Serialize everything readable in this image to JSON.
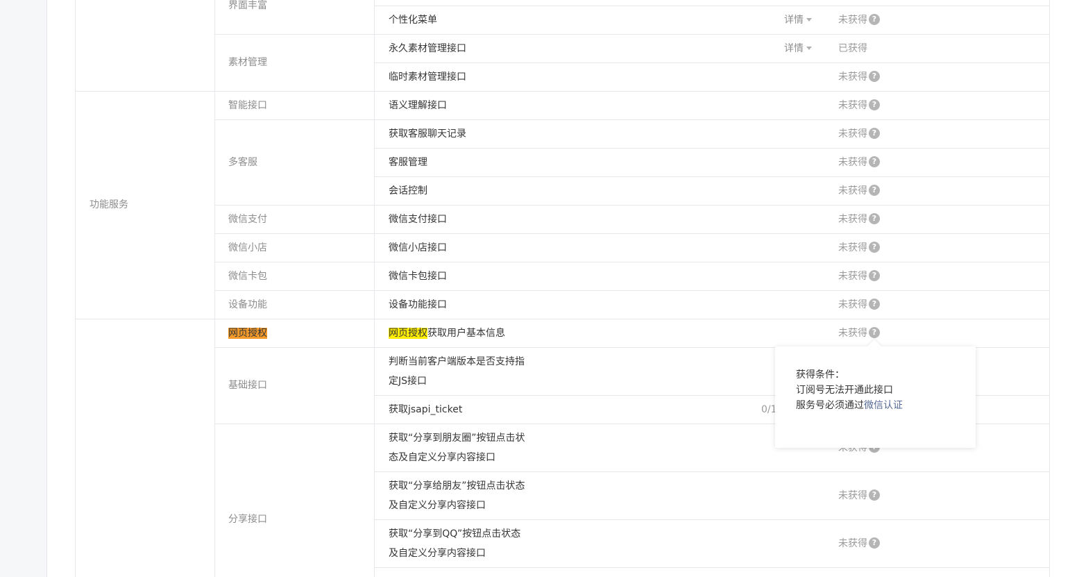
{
  "categories": {
    "interface_rich": "界面丰富",
    "function_service": "功能服务"
  },
  "sub": {
    "material": "素材管理",
    "smart": "智能接口",
    "kf": "多客服",
    "pay": "微信支付",
    "store": "微信小店",
    "card": "微信卡包",
    "device": "设备功能",
    "webauth": "网页授权",
    "basic": "基础接口",
    "share": "分享接口"
  },
  "rows": [
    {
      "api": "个性化菜单",
      "detail": "详情",
      "status": "未获得"
    },
    {
      "api": "永久素材管理接口",
      "detail": "详情",
      "status": "已获得"
    },
    {
      "api": "临时素材管理接口",
      "status": "未获得"
    },
    {
      "api": "语义理解接口",
      "status": "未获得"
    },
    {
      "api": "获取客服聊天记录",
      "status": "未获得"
    },
    {
      "api": "客服管理",
      "status": "未获得"
    },
    {
      "api": "会话控制",
      "status": "未获得"
    },
    {
      "api": "微信支付接口",
      "status": "未获得"
    },
    {
      "api": "微信小店接口",
      "status": "未获得"
    },
    {
      "api": "微信卡包接口",
      "status": "未获得"
    },
    {
      "api": "设备功能接口",
      "status": "未获得"
    },
    {
      "api_highlight": "网页授权",
      "api_rest": "获取用户基本信息",
      "status": "未获得"
    },
    {
      "api_line1": "判断当前客户端版本是否支持指",
      "api_line2": "定JS接口"
    },
    {
      "api": "获取jsapi_ticket",
      "quota": "0/1"
    },
    {
      "api_line1": "获取“分享到朋友圈”按钮点击状",
      "api_line2": "态及自定义分享内容接口",
      "status": "未获得"
    },
    {
      "api_line1": "获取“分享给朋友”按钮点击状态",
      "api_line2": "及自定义分享内容接口",
      "status": "未获得"
    },
    {
      "api_line1": "获取“分享到QQ”按钮点击状态",
      "api_line2": "及自定义分享内容接口",
      "status": "未获得"
    }
  ],
  "qicon": "?",
  "popover": {
    "title": "获得条件：",
    "line1": "订阅号无法开通此接口",
    "line2_prefix": "服务号必须通过",
    "line2_link": "微信认证"
  }
}
